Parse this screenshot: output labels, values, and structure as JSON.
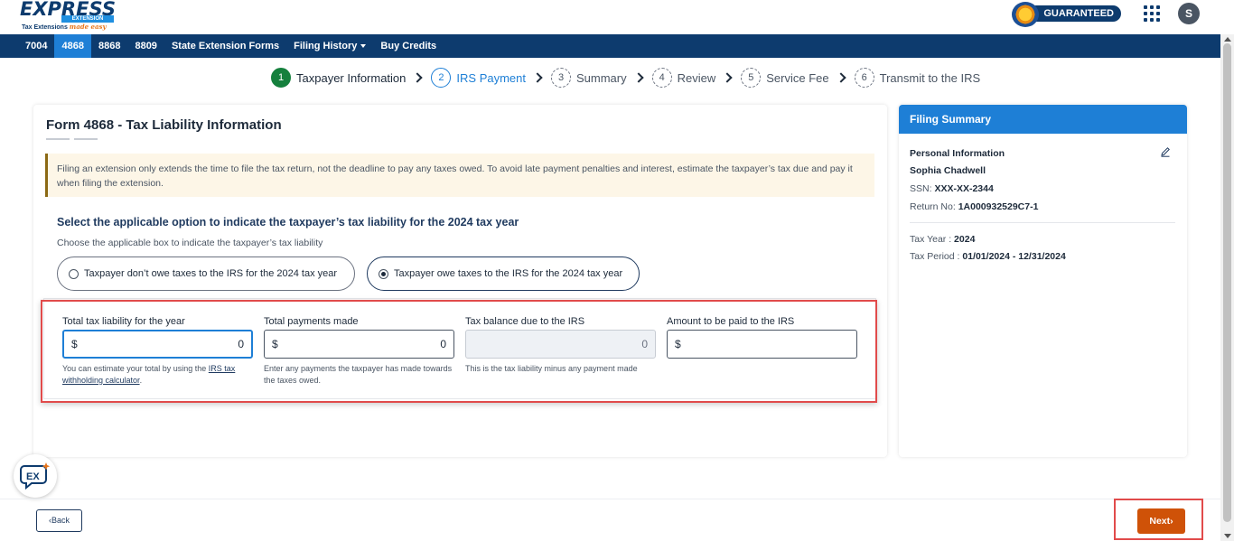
{
  "header": {
    "logo_word": "EXPRESS",
    "logo_bar": "EXTENSION",
    "logo_tagline": "Tax Extensions",
    "logo_tagline_accent": "made easy",
    "guarantee_label": "GUARANTEED",
    "avatar_initial": "S"
  },
  "nav": {
    "items": [
      "7004",
      "4868",
      "8868",
      "8809",
      "State Extension Forms",
      "Filing History",
      "Buy Credits"
    ],
    "active": "4868"
  },
  "stepper": {
    "steps": [
      {
        "num": "1",
        "label": "Taxpayer Information",
        "state": "done"
      },
      {
        "num": "2",
        "label": "IRS Payment",
        "state": "current"
      },
      {
        "num": "3",
        "label": "Summary",
        "state": "pending"
      },
      {
        "num": "4",
        "label": "Review",
        "state": "pending"
      },
      {
        "num": "5",
        "label": "Service Fee",
        "state": "pending"
      },
      {
        "num": "6",
        "label": "Transmit to the IRS",
        "state": "pending"
      }
    ]
  },
  "form": {
    "title": "Form 4868 - Tax Liability Information",
    "notice": "Filing an extension only extends the time to file the tax return, not the deadline to pay any taxes owed. To avoid late payment penalties and interest, estimate the taxpayer’s tax due and pay it when filing the extension.",
    "heading": "Select the applicable option to indicate the taxpayer’s tax liability for the 2024 tax year",
    "subheading": "Choose the applicable box to indicate the taxpayer’s tax liability",
    "options": [
      {
        "label": "Taxpayer don’t owe taxes to the IRS for the 2024 tax year",
        "selected": false
      },
      {
        "label": "Taxpayer owe taxes to the IRS for the 2024 tax year",
        "selected": true
      }
    ],
    "fields": [
      {
        "label": "Total tax liability for the year",
        "prefix": "$",
        "value": "0",
        "help": "You can estimate your total by using the",
        "help_link": "IRS tax withholding calculator",
        "help_end": "."
      },
      {
        "label": "Total payments made",
        "prefix": "$",
        "value": "0",
        "help": "Enter any payments the taxpayer has made towards the taxes owed."
      },
      {
        "label": "Tax balance due to the IRS",
        "prefix": "",
        "value": "0",
        "help": "This is the tax liability minus any payment made"
      },
      {
        "label": "Amount to be paid to the IRS",
        "prefix": "$",
        "value": "",
        "help": ""
      }
    ]
  },
  "summary": {
    "title": "Filing Summary",
    "section": "Personal Information",
    "name": "Sophia Chadwell",
    "ssn_label": "SSN:",
    "ssn": "XXX-XX-2344",
    "return_label": "Return No:",
    "return_no": "1A000932529C7-1",
    "tax_year_label": "Tax Year :",
    "tax_year": "2024",
    "tax_period_label": "Tax Period :",
    "tax_period": "01/01/2024 - 12/31/2024"
  },
  "footer": {
    "back_label": "Back",
    "next_label": "Next"
  },
  "colors": {
    "navy": "#0d3b6e",
    "accent_blue": "#1e7fd6",
    "next_orange": "#cf5208",
    "done_green": "#15803d",
    "highlight_red": "#e14b4b"
  }
}
